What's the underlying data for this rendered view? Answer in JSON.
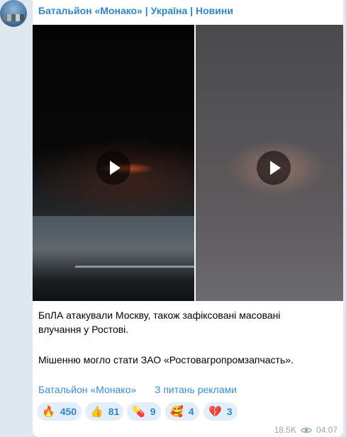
{
  "post": {
    "channel_name": "Батальйон «Монако» | Україна | Новини",
    "text_line1": "БпЛА атакували Москву, також зафіксовані масовані",
    "text_line2": "влучання у Ростові.",
    "text_line3": "Мішенню могло стати ЗАО «Ростовагропромзапчасть».",
    "links": {
      "channel": "Батальйон «Монако»",
      "ads": "З питань реклами"
    },
    "reactions": [
      {
        "emoji_icon": "fire-emoji",
        "emoji": "🔥",
        "count": "450"
      },
      {
        "emoji_icon": "thumbs-up-emoji",
        "emoji": "👍",
        "count": "81"
      },
      {
        "emoji_icon": "pill-emoji",
        "emoji": "💊",
        "count": "9"
      },
      {
        "emoji_icon": "smiling-face-with-hearts-emoji",
        "emoji": "🥰",
        "count": "4"
      },
      {
        "emoji_icon": "broken-heart-emoji",
        "emoji": "💔",
        "count": "3"
      }
    ],
    "views": "18.5K",
    "time": "04:07"
  },
  "colors": {
    "accent": "#2f86c9",
    "link": "#3390d4",
    "reaction_bg": "#e2eef9",
    "page_bg": "#dfe7ef"
  }
}
